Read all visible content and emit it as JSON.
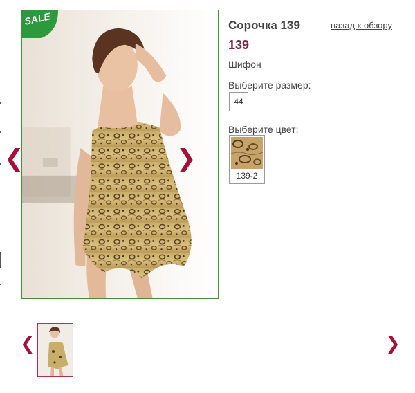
{
  "product": {
    "title": "Сорочка 139",
    "back_link": "назад к обзору",
    "price": "139",
    "material": "Шифон",
    "sale_badge": "SALE"
  },
  "size": {
    "label": "Выберите размер:",
    "options": [
      "44"
    ]
  },
  "color": {
    "label": "Выберите цвет:",
    "options": [
      {
        "code": "139-2"
      }
    ]
  },
  "gallery": {
    "prev_icon": "❮",
    "next_icon": "❯",
    "thumb_prev_icon": "❮",
    "thumb_next_icon": "❯"
  },
  "colors": {
    "accent": "#a3123a",
    "price": "#7a2848",
    "photo_border": "#3f8f3f",
    "sale_green": "#2c9a3c"
  }
}
